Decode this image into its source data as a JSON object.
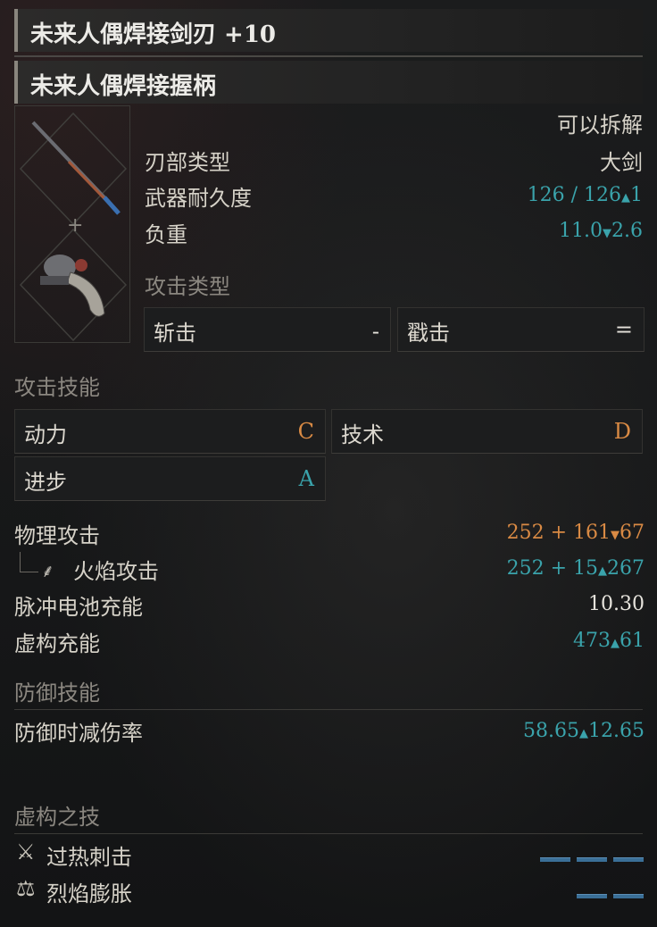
{
  "header": {
    "weapon_title": "未来人偶焊接剑刃 +10",
    "handle_title": "未来人偶焊接握柄"
  },
  "info": {
    "disassemble": "可以拆解",
    "blade_type_label": "刃部类型",
    "blade_type_value": "大剑",
    "durability_label": "武器耐久度",
    "durability_value": "126 / 126",
    "durability_delta": "1",
    "weight_label": "负重",
    "weight_value": "11.0",
    "weight_delta": "2.6",
    "attack_type_label": "攻击类型"
  },
  "attack_types": [
    {
      "label": "斩击",
      "value": "-"
    },
    {
      "label": "戳击",
      "value": "="
    }
  ],
  "sections": {
    "attack_skills": "攻击技能",
    "defense_skills": "防御技能",
    "fable_arts": "虚构之技"
  },
  "skills": [
    {
      "label": "动力",
      "grade": "C"
    },
    {
      "label": "技术",
      "grade": "D"
    },
    {
      "label": "进步",
      "grade": "A"
    }
  ],
  "stats": {
    "physical": {
      "label": "物理攻击",
      "value": "252 + 161",
      "delta": "67"
    },
    "fire": {
      "label": "火焰攻击",
      "value": "252 + 15",
      "delta": "267"
    },
    "pulse": {
      "label": "脉冲电池充能",
      "value": "10.30"
    },
    "fable": {
      "label": "虚构充能",
      "value": "473",
      "delta": "61"
    },
    "guard": {
      "label": "防御时减伤率",
      "value": "58.65",
      "delta": "12.65"
    }
  },
  "fable_arts": [
    {
      "label": "过热刺击",
      "cost_bars": 3
    },
    {
      "label": "烈焰膨胀",
      "cost_bars": 2
    }
  ],
  "colors": {
    "increase": "#3aa3ab",
    "decrease": "#d98a44",
    "fable_bar": "#3a6f97"
  }
}
